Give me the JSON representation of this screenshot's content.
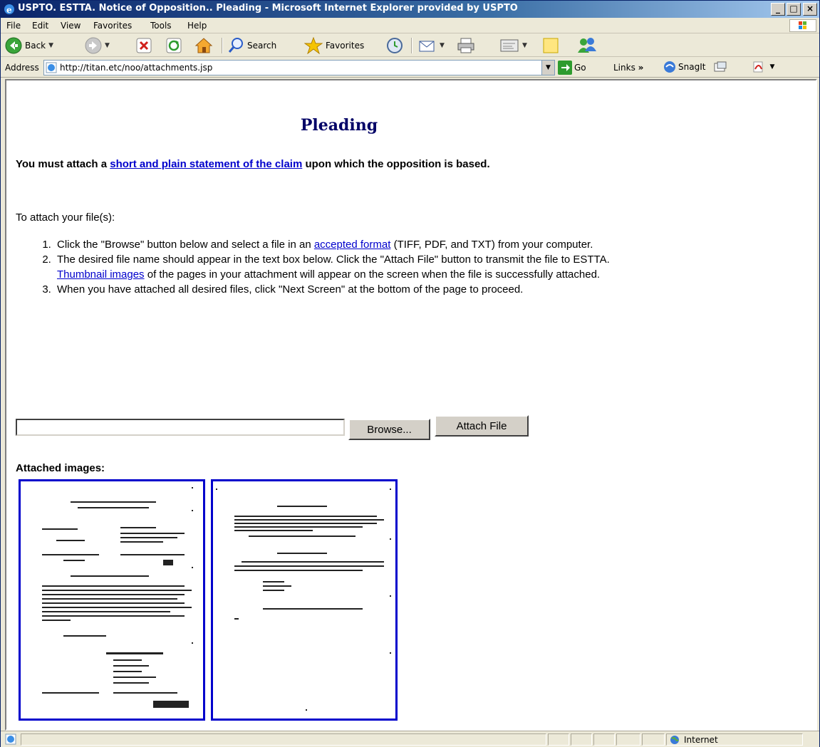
{
  "window": {
    "title": "USPTO. ESTTA. Notice of Opposition.. Pleading - Microsoft Internet Explorer provided by USPTO",
    "controls": {
      "minimize": "_",
      "maximize": "□",
      "close": "×"
    }
  },
  "menu": {
    "items": [
      {
        "key": "F",
        "rest": "ile"
      },
      {
        "key": "E",
        "rest": "dit"
      },
      {
        "key": "V",
        "rest": "iew"
      },
      {
        "key": "a",
        "rest": "Favorites",
        "pre": "F"
      },
      {
        "key": "T",
        "rest": "ools"
      },
      {
        "key": "H",
        "rest": "elp"
      }
    ],
    "labels": [
      "File",
      "Edit",
      "View",
      "Favorites",
      "Tools",
      "Help"
    ]
  },
  "toolbar": {
    "back_label": "Back",
    "search_label": "Search",
    "favorites_label": "Favorites"
  },
  "address": {
    "label": "Address",
    "url": "http://titan.etc/noo/attachments.jsp",
    "go_label": "Go",
    "links_label": "Links",
    "links_chevron": "»",
    "snagit_label": "SnagIt"
  },
  "page": {
    "title": "Pleading",
    "notice_prefix": "You must attach a ",
    "notice_link": "short and plain statement of the claim",
    "notice_suffix": " upon which the opposition is based.",
    "attach_intro": "To attach your file(s):",
    "step1_prefix": "Click the \"Browse\" button below and select a file in an ",
    "step1_link": "accepted format",
    "step1_suffix": " (TIFF, PDF, and TXT) from your computer.",
    "step2_prefix": "The desired file name should appear in the text box below. Click the \"Attach File\" button to transmit the file to ESTTA. ",
    "step2_link": "Thumbnail images",
    "step2_suffix": " of the pages in your attachment will appear on the screen when the file is successfully attached.",
    "step3": "When you have attached all desired files, click \"Next Screen\" at the bottom of the page to proceed.",
    "file_input_value": "",
    "browse_label": "Browse...",
    "attach_label": "Attach File",
    "attached_label": "Attached images:",
    "thumbnails": [
      {
        "name": "page-1"
      },
      {
        "name": "page-2"
      }
    ]
  },
  "status": {
    "zone_label": "Internet"
  },
  "colors": {
    "title_gradient_start": "#0a246a",
    "heading": "#000066",
    "link": "#0000cc",
    "thumb_border": "#0000cc"
  }
}
